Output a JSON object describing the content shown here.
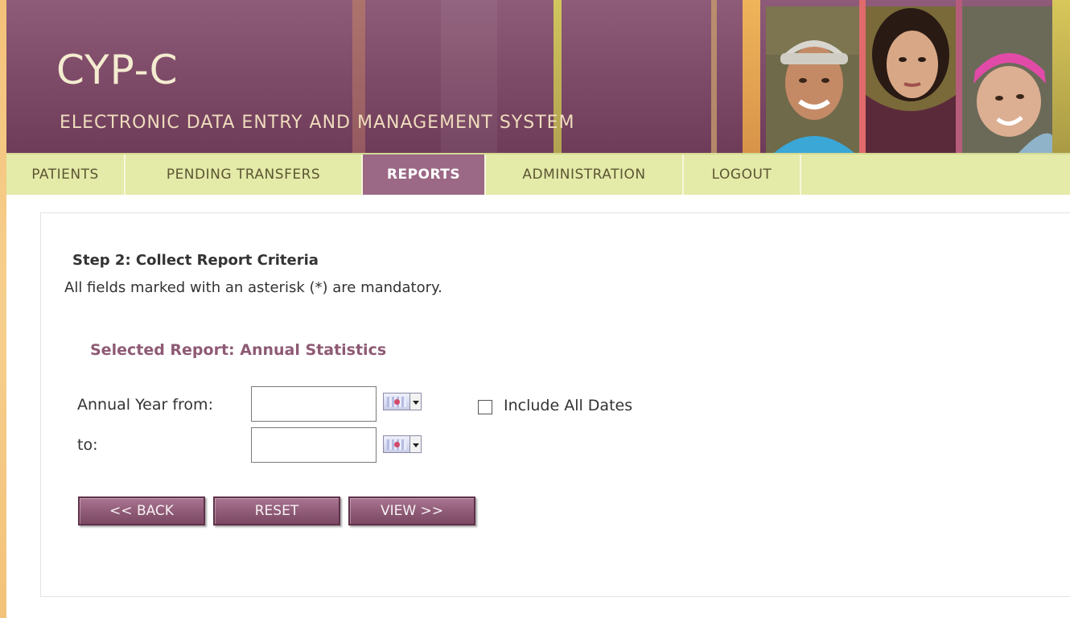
{
  "header": {
    "title": "CYP-C",
    "subtitle": "ELECTRONIC DATA ENTRY AND MANAGEMENT SYSTEM"
  },
  "nav": {
    "items": [
      {
        "label": "PATIENTS"
      },
      {
        "label": "PENDING TRANSFERS"
      },
      {
        "label": "REPORTS"
      },
      {
        "label": "ADMINISTRATION"
      },
      {
        "label": "LOGOUT"
      }
    ],
    "active": "REPORTS"
  },
  "form": {
    "step_title": "Step 2: Collect Report Criteria",
    "step_description": "All fields marked with an asterisk (*) are mandatory.",
    "selected_report": "Selected Report: Annual Statistics",
    "year_from_label": "Annual Year from:",
    "year_from_value": "",
    "year_to_label": "to:",
    "year_to_value": "",
    "include_all_dates_label": "Include All Dates",
    "include_all_dates_checked": false
  },
  "buttons": {
    "back": "<< BACK",
    "reset": "RESET",
    "view": "VIEW >>"
  },
  "colors": {
    "banner": "#7f4c69",
    "nav_background": "#e4eaa8",
    "nav_active": "#9b6885",
    "report_title": "#8e5a74",
    "button": "#8e5a75"
  },
  "icons": [
    "calendar-icon",
    "calendar-icon"
  ]
}
